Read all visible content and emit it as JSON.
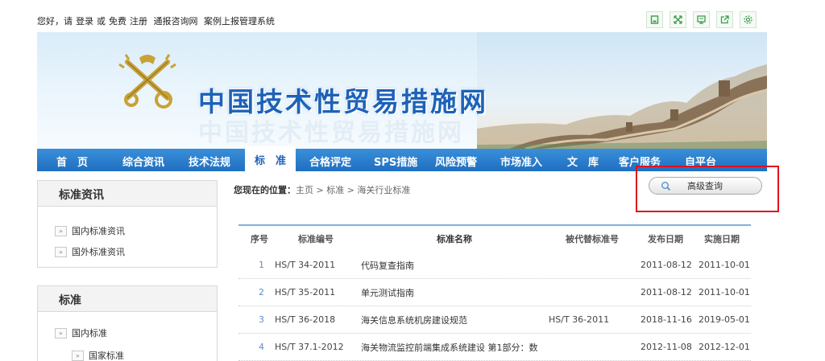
{
  "topbar": {
    "greeting": "您好，请",
    "login": "登录",
    "or": "或",
    "login_free": "免费",
    "register": "注册",
    "link1": "通报咨询网",
    "link2": "案例上报管理系统",
    "tools": [
      "home-icon",
      "fullscreen-icon",
      "monitor-icon",
      "share-icon",
      "settings-icon"
    ]
  },
  "banner": {
    "title": "中国技术性贸易措施网"
  },
  "nav": {
    "items": [
      {
        "label": "首　页"
      },
      {
        "label": "综合资讯"
      },
      {
        "label": "技术法规"
      },
      {
        "label": "标　准"
      },
      {
        "label": "合格评定"
      },
      {
        "label": "SPS措施"
      },
      {
        "label": "风险预警"
      },
      {
        "label": "市场准入"
      },
      {
        "label": "文　库"
      },
      {
        "label": "客户服务"
      },
      {
        "label": "自平台"
      }
    ],
    "active_index": 3
  },
  "sidebar": {
    "box1": {
      "title": "标准资讯",
      "items": [
        {
          "label": "国内标准资讯"
        },
        {
          "label": "国外标准资讯"
        }
      ]
    },
    "box2": {
      "title": "标准",
      "items": [
        {
          "label": "国内标准"
        },
        {
          "label": "国家标准"
        }
      ]
    }
  },
  "breadcrumb": {
    "prefix": "您现在的位置：",
    "path": "主页 > 标准 > 海关行业标准"
  },
  "search": {
    "advanced_label": "高级查询"
  },
  "table": {
    "headers": [
      "序号",
      "标准编号",
      "标准名称",
      "被代替标准号",
      "发布日期",
      "实施日期"
    ],
    "rows": [
      {
        "no": "1",
        "code": "HS/T 34-2011",
        "name": "代码复查指南",
        "replaced": "",
        "publish": "2011-08-12",
        "implement": "2011-10-01"
      },
      {
        "no": "2",
        "code": "HS/T 35-2011",
        "name": "单元测试指南",
        "replaced": "",
        "publish": "2011-08-12",
        "implement": "2011-10-01"
      },
      {
        "no": "3",
        "code": "HS/T 36-2018",
        "name": "海关信息系统机房建设规范",
        "replaced": "HS/T 36-2011",
        "publish": "2018-11-16",
        "implement": "2019-05-01"
      },
      {
        "no": "4",
        "code": "HS/T 37.1-2012",
        "name": "海关物流监控前端集成系统建设 第1部分：数",
        "replaced": "",
        "publish": "2012-11-08",
        "implement": "2012-12-01"
      }
    ]
  }
}
